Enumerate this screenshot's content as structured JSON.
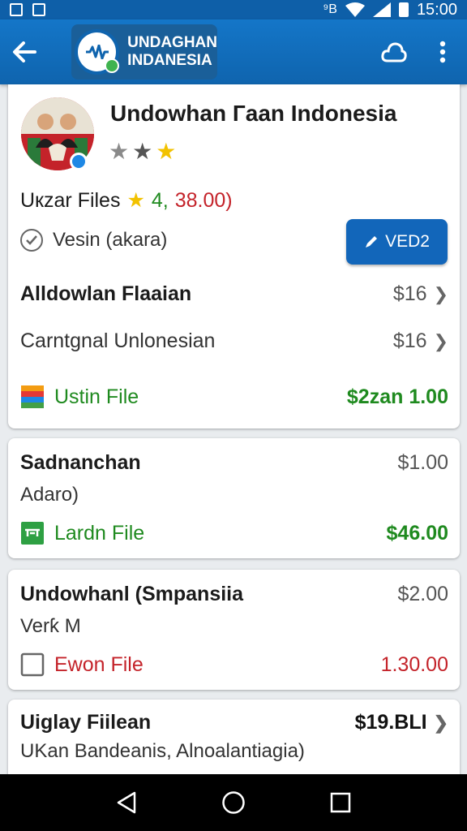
{
  "status_bar": {
    "time": "15:00",
    "signal_text": "⁹B"
  },
  "app_bar": {
    "logo_line1": "UNDAGHAN",
    "logo_line2": "INDANESIA",
    "icons": [
      "back-arrow-icon",
      "cloud-icon",
      "more-vert-icon"
    ]
  },
  "profile": {
    "name": "Undowhan Гaan Indonesia",
    "stars": [
      "gray",
      "dark",
      "gold"
    ]
  },
  "files_line": {
    "label": "Uкzar Files",
    "rating": "4,",
    "price": "38.00)"
  },
  "version": {
    "label": "Vesin (akara)",
    "edit_button": "VED2"
  },
  "card1_rows": [
    {
      "label": "Alldowlan Flaaian",
      "value": "$16"
    },
    {
      "label": "Carntgnal Unlonesian",
      "value": "$16"
    }
  ],
  "card1_file": {
    "name": "Ustin File",
    "value": "$2zan 1.00"
  },
  "card2": {
    "title": "Sadnanchan",
    "value": "$1.00",
    "subtitle": "Adaro)",
    "file_name": "Lardn File",
    "file_value": "$46.00"
  },
  "card3": {
    "title": "Undowhanl (Smpansiia",
    "value": "$2.00",
    "subtitle": "Verƙ M",
    "file_name": "Ewon File",
    "file_value": "1.30.00"
  },
  "card4": {
    "title": "Uiglay Fiilean",
    "value": "$19.BLI",
    "subtitle": "UKan Bandeanis, Alnoalantiagia)"
  },
  "colors": {
    "primary": "#1266ba",
    "green": "#1f8a1f",
    "red": "#c4232a",
    "gold": "#f2c200"
  }
}
